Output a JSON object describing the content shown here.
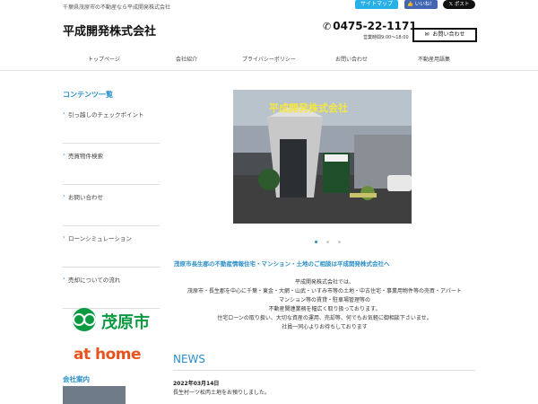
{
  "header": {
    "tagline": "千葉県茂原市の不動産なら平成開発株式会社",
    "site_title": "平成開発株式会社",
    "phone": "0475-22-1171",
    "hours": "営業時間9:00～18:00",
    "contact_button": "お問い合わせ",
    "sitemap_button": "サイトマップ",
    "like_button": "👍 いいね！",
    "post_button": "𝕏 ポスト"
  },
  "nav": {
    "items": [
      "トップページ",
      "会社紹介",
      "プライバシーポリシー",
      "お問い合わせ",
      "不動産用語集"
    ]
  },
  "sidebar": {
    "title": "コンテンツ一覧",
    "items": [
      "引っ越しのチェックポイント",
      "売買物件検索",
      "お問い合わせ",
      "ローンシミュレーション",
      "売却についての流れ"
    ],
    "banner_mobara": "茂原市",
    "banner_athome": "at home",
    "company_info_title": "会社案内"
  },
  "main": {
    "hero_caption": "平成開発株式会社",
    "headline": "茂原市長生郡の不動産情報住宅・マンション・土地のご相談は平成開発株式会社へ",
    "intro_lines": [
      "平成開発株式会社では、",
      "茂原市・長生郡を中心に千葉・東金・大網・山武・いすみ市等の土地・中古住宅・事業用物件等の売買・アパート",
      "マンション等の賃貸・駐車場管理等の",
      "不動産関連業務を幅広く取り扱っております。",
      "住宅ローンの取り扱い、大切な資産の運用、売却等、何でもお気軽に御相談下さいませ。",
      "社員一同心よりお待ちしております"
    ],
    "news_title": "NEWS",
    "news_date": "2022年03月14日",
    "news_text": "長生村一ツ松丙土地をお預りしました。"
  },
  "colors": {
    "accent": "#2a8fc9",
    "mobara_green": "#0b9a41",
    "athome_orange": "#e8541d"
  }
}
